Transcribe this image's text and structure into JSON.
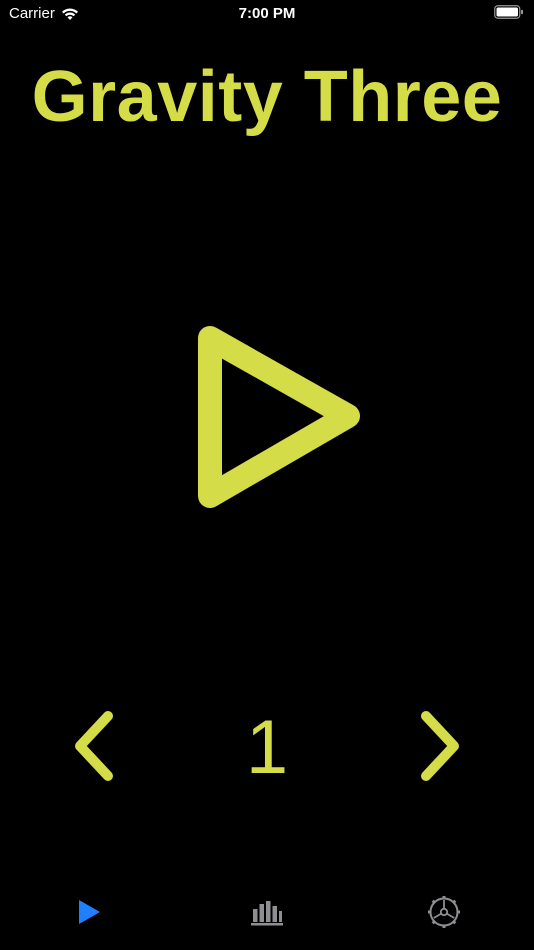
{
  "status_bar": {
    "carrier": "Carrier",
    "time": "7:00 PM"
  },
  "app": {
    "title": "Gravity Three"
  },
  "level_selector": {
    "level": "1"
  },
  "colors": {
    "accent": "#d4dc47",
    "background": "#000000",
    "tab_active": "#1f7fff",
    "tab_inactive": "#8e8e93"
  },
  "tabs": [
    {
      "icon": "play-icon",
      "active": true
    },
    {
      "icon": "bar-chart-icon",
      "active": false
    },
    {
      "icon": "gear-icon",
      "active": false
    }
  ]
}
